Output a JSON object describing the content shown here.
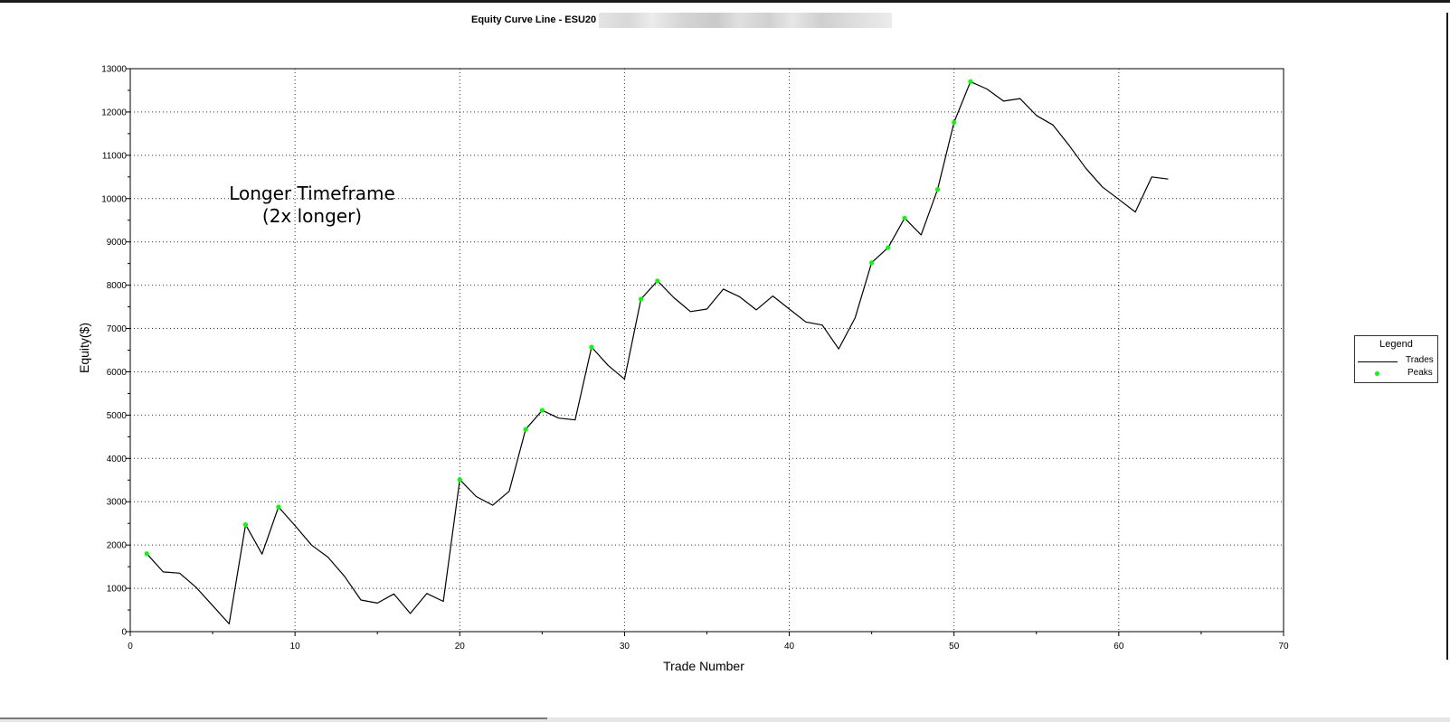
{
  "window": {
    "title": "Equity Curve Line - ESU20"
  },
  "legend": {
    "title": "Legend",
    "items": [
      "Trades",
      "Peaks"
    ]
  },
  "annotation": {
    "line1": "Longer Timeframe",
    "line2": "(2x longer)"
  },
  "colors": {
    "line": "#000000",
    "peaks": "#00ff00",
    "grid": "#333333"
  },
  "chart_data": {
    "type": "line",
    "title": "Equity Curve Line - ESU20",
    "xlabel": "Trade Number",
    "ylabel": "Equity($)",
    "xlim": [
      0,
      70
    ],
    "ylim": [
      0,
      13000
    ],
    "xticks": [
      0,
      10,
      20,
      30,
      40,
      50,
      60,
      70
    ],
    "yticks": [
      0,
      1000,
      2000,
      3000,
      4000,
      5000,
      6000,
      7000,
      8000,
      9000,
      10000,
      11000,
      12000,
      13000
    ],
    "grid": true,
    "legend_position": "right",
    "series": [
      {
        "name": "Trades",
        "x": [
          1,
          2,
          3,
          4,
          5,
          6,
          7,
          8,
          9,
          10,
          11,
          12,
          13,
          14,
          15,
          16,
          17,
          18,
          19,
          20,
          21,
          22,
          23,
          24,
          25,
          26,
          27,
          28,
          29,
          30,
          31,
          32,
          33,
          34,
          35,
          36,
          37,
          38,
          39,
          40,
          41,
          42,
          43,
          44,
          45,
          46,
          47,
          48,
          49,
          50,
          51,
          52,
          53,
          54,
          55,
          56,
          57,
          58,
          59,
          60,
          61,
          62,
          63
        ],
        "values": [
          1800,
          1380,
          1350,
          1020,
          600,
          180,
          2470,
          1790,
          2880,
          2450,
          2000,
          1720,
          1280,
          730,
          660,
          870,
          420,
          880,
          700,
          3510,
          3120,
          2920,
          3240,
          4670,
          5110,
          4930,
          4890,
          6570,
          6150,
          5830,
          7680,
          8100,
          7710,
          7390,
          7450,
          7910,
          7730,
          7430,
          7750,
          7450,
          7150,
          7080,
          6530,
          7250,
          8520,
          8870,
          9550,
          9160,
          10210,
          11760,
          12700,
          12530,
          12250,
          12310,
          11920,
          11700,
          11220,
          10700,
          10270,
          9980,
          9690,
          10500,
          10450
        ]
      },
      {
        "name": "Peaks",
        "x": [
          1,
          7,
          9,
          20,
          24,
          25,
          28,
          31,
          32,
          45,
          46,
          47,
          49,
          50,
          51
        ],
        "values": [
          1800,
          2470,
          2880,
          3510,
          4670,
          5110,
          6570,
          7680,
          8100,
          8520,
          8870,
          9550,
          10210,
          11760,
          12700
        ]
      }
    ]
  }
}
